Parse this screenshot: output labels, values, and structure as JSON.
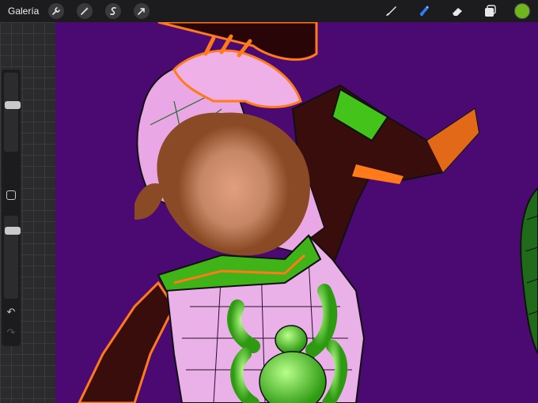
{
  "topbar": {
    "gallery_label": "Galería",
    "left_tools": [
      {
        "name": "wrench-icon"
      },
      {
        "name": "magic-wand-icon"
      },
      {
        "name": "selection-icon"
      },
      {
        "name": "transform-arrow-icon"
      }
    ],
    "right_tools": [
      {
        "name": "brush-icon"
      },
      {
        "name": "smudge-icon"
      },
      {
        "name": "eraser-icon"
      },
      {
        "name": "layers-icon"
      }
    ],
    "active_tool": "smudge-icon",
    "current_color": "#6fb51c",
    "accent_color": "#2f7cf6"
  },
  "sidebar": {
    "brush_size_level": 0.28,
    "opacity_level": 0.18
  },
  "canvas": {
    "background_color": "#4a0a72"
  }
}
